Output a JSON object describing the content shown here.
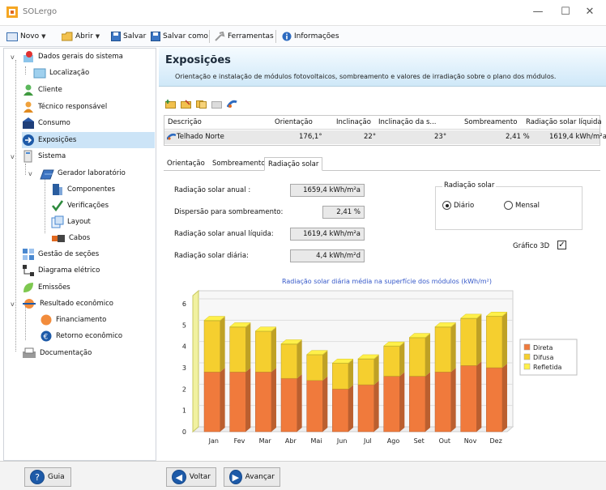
{
  "app": {
    "title": "SOLergo"
  },
  "toolbar": {
    "novo": "Novo",
    "abrir": "Abrir",
    "salvar": "Salvar",
    "salvar_como": "Salvar como",
    "ferramentas": "Ferramentas",
    "informacoes": "Informações"
  },
  "sidebar": {
    "dados_gerais": "Dados gerais do sistema",
    "localizacao": "Localização",
    "cliente": "Cliente",
    "tecnico": "Técnico responsável",
    "consumo": "Consumo",
    "exposicoes": "Exposições",
    "sistema": "Sistema",
    "gerador": "Gerador laboratório",
    "componentes": "Componentes",
    "verificacoes": "Verificações",
    "layout": "Layout",
    "cabos": "Cabos",
    "gestao": "Gestão de seções",
    "diagrama": "Diagrama elétrico",
    "emissoes": "Emissões",
    "resultado": "Resultado econômico",
    "financiamento": "Financiamento",
    "retorno": "Retorno econômico",
    "documentacao": "Documentação"
  },
  "header": {
    "title": "Exposições",
    "subtitle": "Orientação e instalação de módulos fotovoltaicos, sombreamento e valores de irradiação sobre o plano dos módulos."
  },
  "grid": {
    "columns": [
      "Descrição",
      "Orientação",
      "Inclinação",
      "Inclinação da s...",
      "Sombreamento",
      "Radiação solar líquida"
    ],
    "row": [
      "Telhado Norte",
      "176,1°",
      "22°",
      "23°",
      "2,41 %",
      "1619,4 kWh/m²a"
    ]
  },
  "tabs": {
    "orientacao": "Orientação",
    "sombreamento": "Sombreamento",
    "radiacao": "Radiação solar"
  },
  "fields": {
    "anual_label": "Radiação solar anual :",
    "anual_value": "1659,4 kWh/m²a",
    "dispersao_label": "Dispersão para sombreamento:",
    "dispersao_value": "2,41 %",
    "liquida_label": "Radiação solar anual líquida:",
    "liquida_value": "1619,4 kWh/m²a",
    "diaria_label": "Radiação solar diária:",
    "diaria_value": "4,4 kWh/m²d"
  },
  "radio_group": {
    "title": "Radiação solar",
    "diario": "Diário",
    "mensal": "Mensal",
    "selected": "Diário"
  },
  "grafico3d": {
    "label": "Gráfico 3D",
    "checked": true
  },
  "bottom": {
    "guia": "Guia",
    "voltar": "Voltar",
    "avancar": "Avançar"
  },
  "chart_data": {
    "type": "bar",
    "title": "Radiação solar diária média na superfície dos módulos (kWh/m²)",
    "categories": [
      "Jan",
      "Fev",
      "Mar",
      "Abr",
      "Mai",
      "Jun",
      "Jul",
      "Ago",
      "Set",
      "Out",
      "Nov",
      "Dez"
    ],
    "stacked": true,
    "series": [
      {
        "name": "Direta",
        "color": "#f07a3c",
        "values": [
          2.8,
          2.8,
          2.8,
          2.5,
          2.4,
          2.0,
          2.2,
          2.6,
          2.6,
          2.8,
          3.1,
          3.0
        ]
      },
      {
        "name": "Difusa",
        "color": "#f5cf2f",
        "values": [
          2.4,
          2.1,
          1.9,
          1.6,
          1.2,
          1.2,
          1.2,
          1.4,
          1.8,
          2.1,
          2.2,
          2.4
        ]
      },
      {
        "name": "Refletida",
        "color": "#fff04a",
        "values": [
          0.02,
          0.02,
          0.02,
          0.02,
          0.02,
          0.02,
          0.02,
          0.02,
          0.02,
          0.02,
          0.02,
          0.02
        ]
      }
    ],
    "ylim": [
      0,
      6
    ],
    "yticks": [
      "0",
      "1",
      "2",
      "3",
      "4",
      "5",
      "6"
    ],
    "legend": "right"
  }
}
